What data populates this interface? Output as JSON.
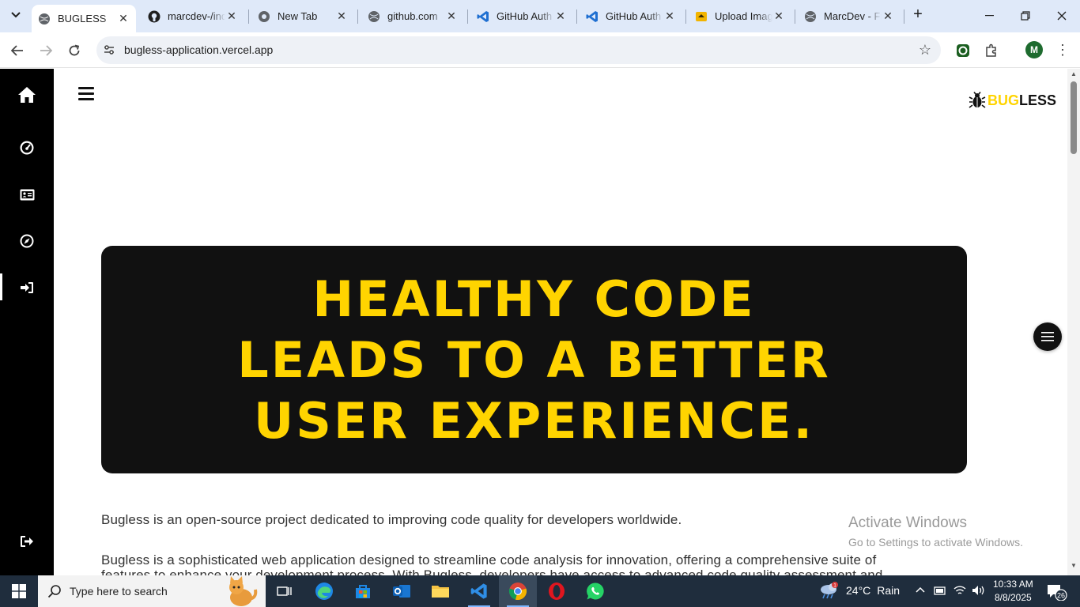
{
  "browser": {
    "tabs": [
      {
        "title": "BUGLESS",
        "icon": "globe-icon",
        "active": true
      },
      {
        "title": "marcdev-/index",
        "icon": "github-icon"
      },
      {
        "title": "New Tab",
        "icon": "chrome-icon"
      },
      {
        "title": "github.com",
        "icon": "globe-icon"
      },
      {
        "title": "GitHub Auth",
        "icon": "vscode-icon"
      },
      {
        "title": "GitHub Auth",
        "icon": "vscode-icon"
      },
      {
        "title": "Upload Image",
        "icon": "upload-icon"
      },
      {
        "title": "MarcDev - Fr",
        "icon": "globe-icon"
      }
    ],
    "url": "bugless-application.vercel.app",
    "profile_initial": "M"
  },
  "page": {
    "brand_highlight": "BUG",
    "brand_rest": "LESS",
    "hero_heading": "HEALTHY CODE LEADS TO A BETTER USER EXPERIENCE.",
    "intro": "Bugless is an open-source project dedicated to improving code quality for developers worldwide.",
    "description_line1": "Bugless is a sophisticated web application designed to streamline code analysis for innovation, offering a comprehensive suite of",
    "description_line2": "features to enhance your development process. With Bugless, developers have access to advanced code quality assessment and",
    "sidebar": [
      "home",
      "dashboard",
      "profile-card",
      "explore",
      "login",
      "logout"
    ]
  },
  "watermark": {
    "title": "Activate Windows",
    "subtitle": "Go to Settings to activate Windows."
  },
  "taskbar": {
    "search_placeholder": "Type here to search",
    "weather_temp": "24°C",
    "weather_text": "Rain",
    "weather_badge": "1",
    "time": "10:33 AM",
    "date": "8/8/2025",
    "notifications": "26"
  },
  "colors": {
    "accent": "#ffd400",
    "sidebar": "#000000",
    "hero_bg": "#111111"
  }
}
